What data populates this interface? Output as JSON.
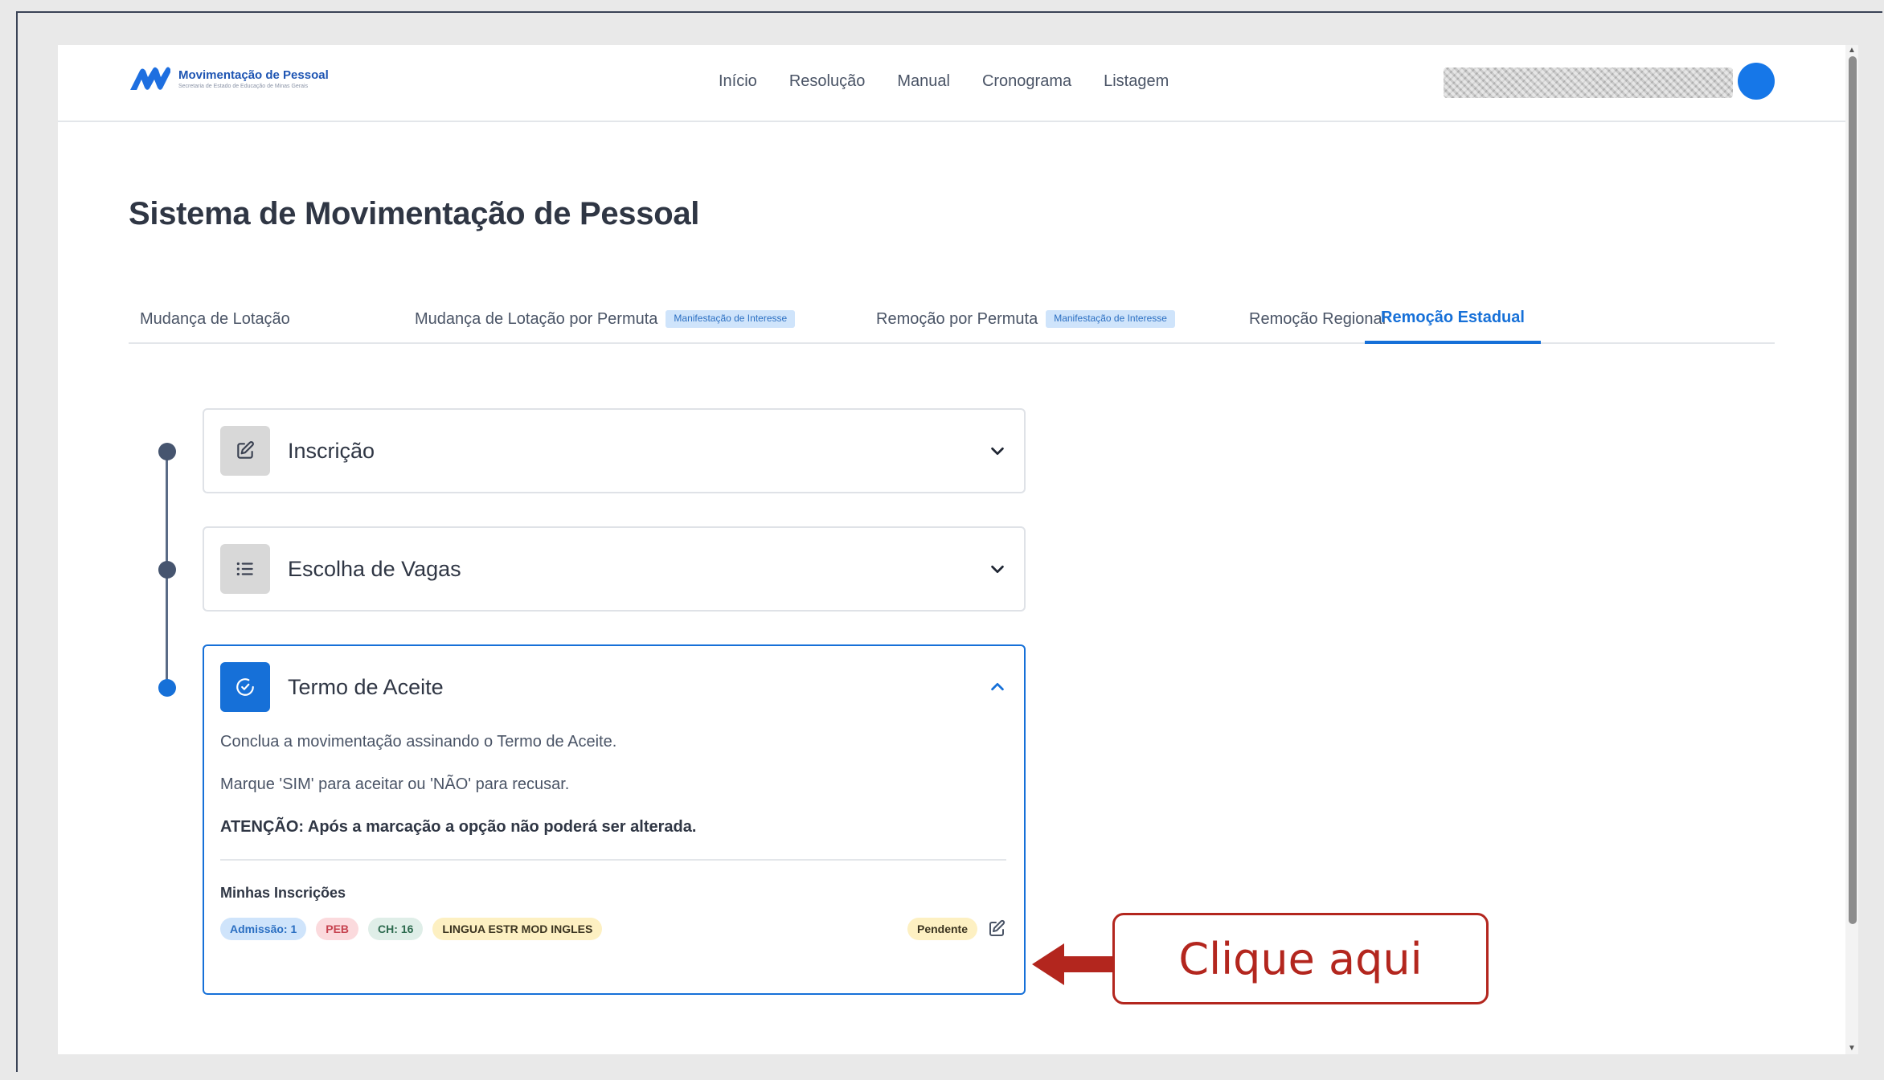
{
  "header": {
    "logo_title": "Movimentação de Pessoal",
    "logo_subtitle": "Secretaria de Estado de Educação de Minas Gerais",
    "nav": [
      "Início",
      "Resolução",
      "Manual",
      "Cronograma",
      "Listagem"
    ]
  },
  "page_title": "Sistema de Movimentação de Pessoal",
  "tabs": [
    {
      "label": "Mudança de Lotação",
      "badge": ""
    },
    {
      "label": "Mudança de Lotação por Permuta",
      "badge": "Manifestação de Interesse"
    },
    {
      "label": "Remoção por Permuta",
      "badge": "Manifestação de Interesse"
    },
    {
      "label": "Remoção Regional",
      "badge": ""
    },
    {
      "label": "Remoção Estadual",
      "badge": "",
      "active": true
    }
  ],
  "steps": [
    {
      "title": "Inscrição",
      "icon": "edit-icon",
      "expanded": false
    },
    {
      "title": "Escolha de Vagas",
      "icon": "list-icon",
      "expanded": false
    },
    {
      "title": "Termo de Aceite",
      "icon": "check-circle-icon",
      "expanded": true
    }
  ],
  "termo": {
    "p1": "Conclua a movimentação assinando o Termo de Aceite.",
    "p2": "Marque 'SIM' para aceitar ou 'NÃO' para recusar.",
    "p3": "ATENÇÃO: Após a marcação a opção não poderá ser alterada.",
    "minhas_inscricoes": "Minhas Inscrições",
    "chips": {
      "admissao": "Admissão: 1",
      "peb": "PEB",
      "ch": "CH: 16",
      "lingua": "LINGUA ESTR MOD INGLES",
      "status": "Pendente"
    }
  },
  "annotation": {
    "text": "Clique aqui"
  },
  "colors": {
    "accent": "#1670d8",
    "annotation": "#b3261e",
    "avatar": "#1677e8"
  }
}
